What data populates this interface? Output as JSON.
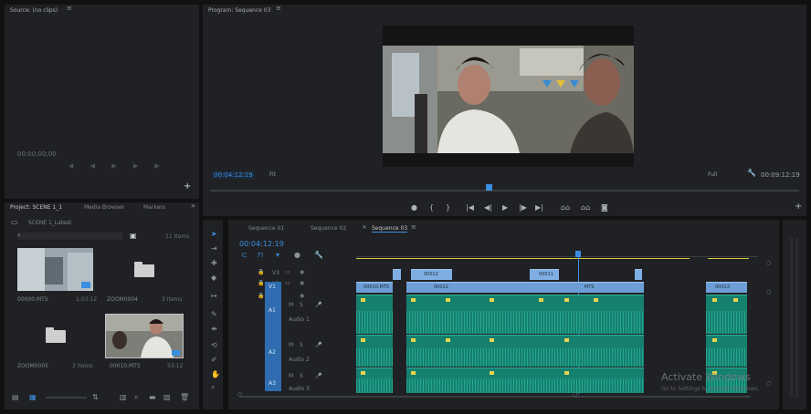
{
  "source_monitor": {
    "title": "Source: (no clips)",
    "timecode": "00;00;00;00"
  },
  "program_monitor": {
    "title": "Program: Sequence 03",
    "timecode_current": "00:04:12:19",
    "fit_label": "Fit",
    "quality_label": "Full",
    "timecode_duration": "00:09:12:19"
  },
  "project_panel": {
    "tabs": [
      "Project: SCENE 1_1",
      "Media Browser",
      "Markers"
    ],
    "bin_path": "SCENE 1_Latest",
    "items_count": "11 Items",
    "items": [
      {
        "name": "00000.MTS",
        "meta": "1:03:12",
        "kind": "video"
      },
      {
        "name": "ZOOM0004",
        "meta": "3 Items",
        "kind": "folder"
      },
      {
        "name": "ZOOM0005",
        "meta": "3 Items",
        "kind": "folder"
      },
      {
        "name": "00010.MTS",
        "meta": "53:12",
        "kind": "video"
      }
    ]
  },
  "timeline": {
    "tabs": [
      "Sequence 01",
      "Sequence 02",
      "Sequence 03"
    ],
    "active_tab": "Sequence 03",
    "timecode": "00:04:12:19",
    "tracks": {
      "v3": "V3",
      "v2": "V2",
      "v1": "V1",
      "a1": "A1",
      "a1_name": "Audio 1",
      "a2": "A2",
      "a2_name": "Audio 2",
      "a3": "A3",
      "a3_name": "Audio 3"
    },
    "clip_labels": [
      "00010.MTS",
      "00012",
      "00011",
      "00012",
      "MTS",
      "00013"
    ]
  },
  "watermark": {
    "line1": "Activate Windows",
    "line2": "Go to Settings to activate Windows."
  },
  "colors": {
    "accent": "#3b8fe0",
    "panel": "#202124",
    "video_clip": "#6d9fd6",
    "audio_clip": "#16806f"
  }
}
